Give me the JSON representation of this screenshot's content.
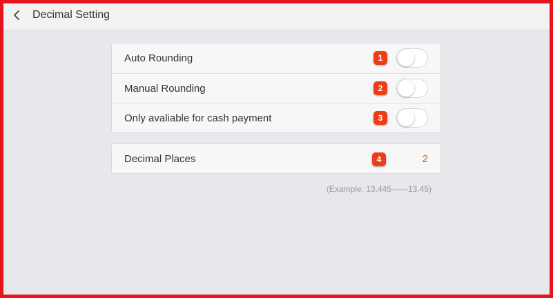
{
  "header": {
    "title": "Decimal Setting",
    "back_icon": "chevron-left-icon"
  },
  "settings": {
    "toggles": [
      {
        "label": "Auto Rounding",
        "badge": "1",
        "enabled": false
      },
      {
        "label": "Manual Rounding",
        "badge": "2",
        "enabled": false
      },
      {
        "label": "Only avaliable for cash payment",
        "badge": "3",
        "enabled": false
      }
    ],
    "decimal_places": {
      "label": "Decimal Places",
      "badge": "4",
      "value": "2"
    },
    "example": "(Example: 13.445——13.45)"
  },
  "colors": {
    "frame_border": "#e8141b",
    "background": "#e7e8ec",
    "badge": "#ee3c14",
    "value_accent": "#c4631a"
  }
}
